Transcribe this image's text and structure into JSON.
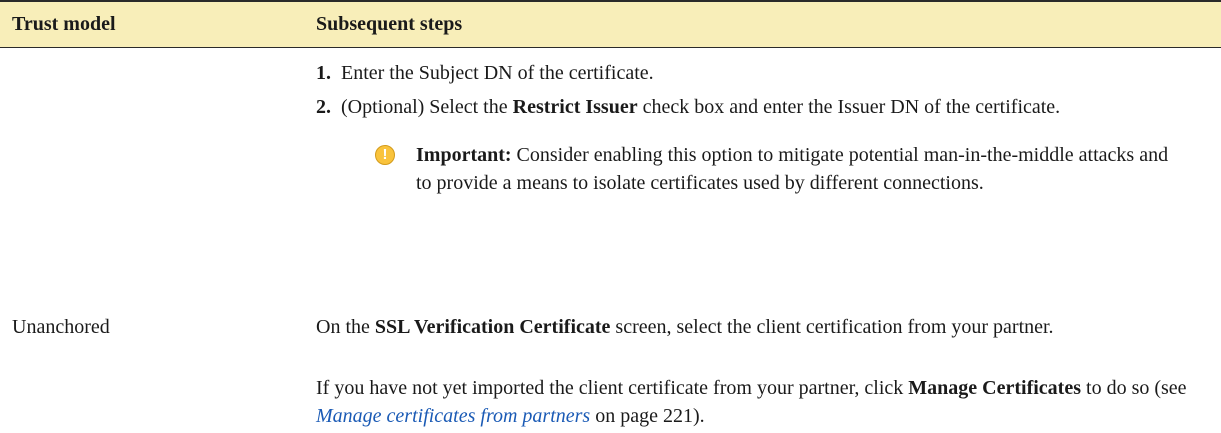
{
  "table": {
    "headers": {
      "trust_model": "Trust model",
      "subsequent_steps": "Subsequent steps"
    },
    "rows": [
      {
        "trust_model": "",
        "steps": [
          {
            "number": "1.",
            "text": "Enter the Subject DN of the certificate."
          },
          {
            "number": "2.",
            "pre": "(Optional) Select the ",
            "bold": "Restrict Issuer",
            "post": " check box and enter the Issuer DN of the certificate."
          }
        ],
        "note": {
          "icon": "important-icon",
          "label": "Important:",
          "text": " Consider enabling this option to mitigate potential man-in-the-middle attacks and to provide a means to isolate certificates used by different connections."
        }
      },
      {
        "trust_model": "Unanchored",
        "para1": {
          "pre": "On the ",
          "bold": "SSL Verification Certificate",
          "post": " screen, select the client certification from your partner."
        },
        "para2": {
          "pre": "If you have not yet imported the client certificate from your partner, click ",
          "bold": "Manage Certificates",
          "mid": " to do so (see ",
          "link": "Manage certificates from partners",
          "post": " on page 221)."
        }
      }
    ]
  },
  "colors": {
    "header_bg": "#f8eeb9",
    "link": "#1a5ab5",
    "important_icon": "#f9c33c"
  }
}
